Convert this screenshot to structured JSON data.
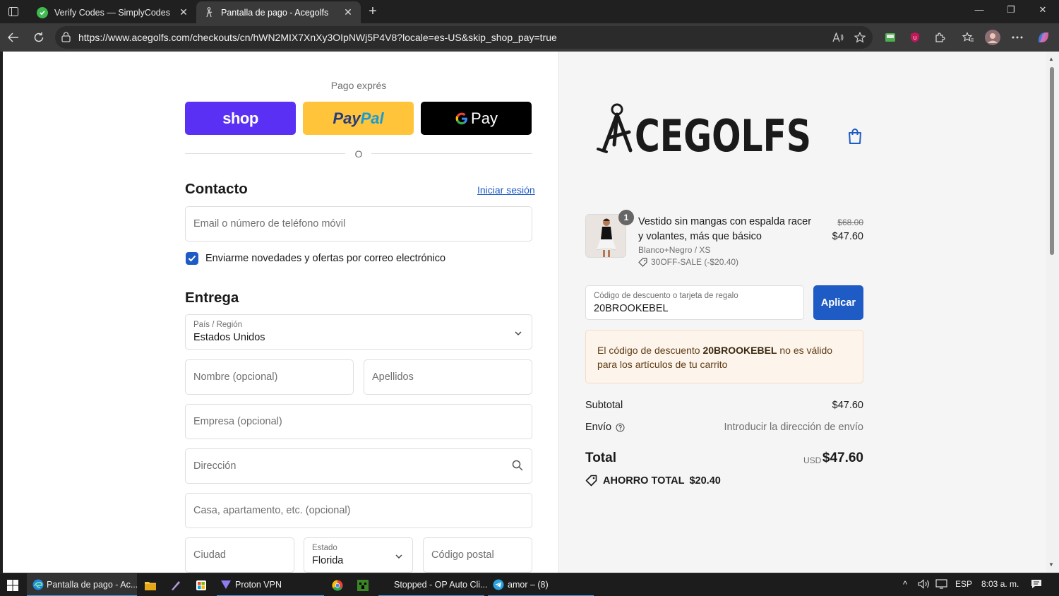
{
  "browser": {
    "tabs": [
      {
        "title": "Verify Codes — SimplyCodes",
        "active": false
      },
      {
        "title": "Pantalla de pago - Acegolfs",
        "active": true
      }
    ],
    "url": "https://www.acegolfs.com/checkouts/cn/hWN2MIX7XnXy3OIpNWj5P4V8?locale=es-US&skip_shop_pay=true"
  },
  "checkout": {
    "express_label": "Pago exprés",
    "express_buttons": {
      "shop": "shop",
      "paypal_a": "Pay",
      "paypal_b": "Pal",
      "gpay": "Pay"
    },
    "or_label": "O",
    "contact": {
      "heading": "Contacto",
      "login_link": "Iniciar sesión",
      "email_placeholder": "Email o número de teléfono móvil",
      "newsletter_label": "Enviarme novedades y ofertas por correo electrónico",
      "newsletter_checked": true
    },
    "delivery": {
      "heading": "Entrega",
      "country_label": "País / Región",
      "country_value": "Estados Unidos",
      "first_name_placeholder": "Nombre (opcional)",
      "last_name_placeholder": "Apellidos",
      "company_placeholder": "Empresa (opcional)",
      "address_placeholder": "Dirección",
      "apartment_placeholder": "Casa, apartamento, etc. (opcional)",
      "city_placeholder": "Ciudad",
      "state_label": "Estado",
      "state_value": "Florida",
      "zip_placeholder": "Código postal"
    }
  },
  "summary": {
    "brand": "CEGOLFS",
    "product": {
      "quantity": "1",
      "name": "Vestido sin mangas con espalda racer y volantes, más que básico",
      "variant": "Blanco+Negro / XS",
      "discount": "30OFF-SALE (-$20.40)",
      "price_original": "$68.00",
      "price": "$47.60"
    },
    "discount_field": {
      "label": "Código de descuento o tarjeta de regalo",
      "value": "20BROOKEBEL",
      "apply_label": "Aplicar"
    },
    "error": {
      "prefix": "El código de descuento ",
      "code": "20BROOKEBEL",
      "suffix": " no es válido para los artículos de tu carrito"
    },
    "subtotal_label": "Subtotal",
    "subtotal_value": "$47.60",
    "shipping_label": "Envío",
    "shipping_value": "Introducir la dirección de envío",
    "total_label": "Total",
    "total_currency": "USD",
    "total_value": "$47.60",
    "savings_label": "AHORRO TOTAL",
    "savings_value": "$20.40"
  },
  "taskbar": {
    "items": [
      {
        "label": "Pantalla de pago - Ac..."
      },
      {
        "label": "Proton VPN"
      },
      {
        "label": "Stopped - OP Auto Cli..."
      },
      {
        "label": "amor – (8)"
      }
    ],
    "language": "ESP",
    "time": "8:03 a. m."
  },
  "colors": {
    "accent": "#1f5bc5",
    "shop": "#5a31f4",
    "paypal": "#ffc439",
    "gpay": "#000000",
    "error_bg": "#fdf4ec"
  }
}
